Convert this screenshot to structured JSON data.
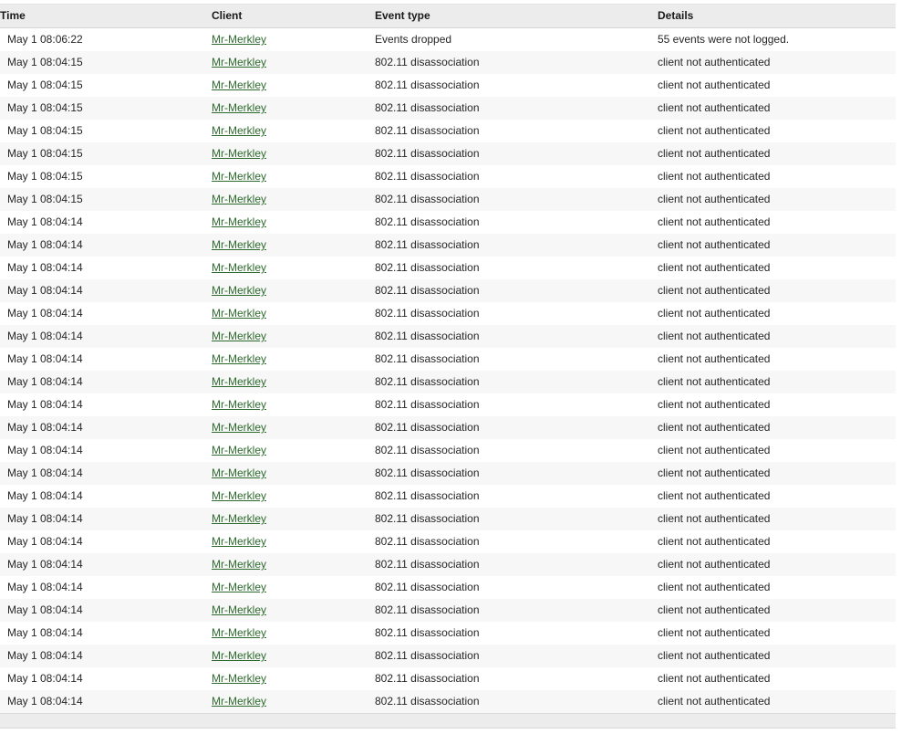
{
  "table": {
    "columns": [
      {
        "key": "time",
        "label": "Time"
      },
      {
        "key": "client",
        "label": "Client"
      },
      {
        "key": "event",
        "label": "Event type"
      },
      {
        "key": "details",
        "label": "Details"
      }
    ],
    "link_color": "#2d6a2d",
    "header_background": "#ececec",
    "stripe_color": "#f7f7f7",
    "rows": [
      {
        "time": "May 1 08:06:22",
        "client": "Mr-Merkley",
        "event": "Events dropped",
        "details": "55 events were not logged."
      },
      {
        "time": "May 1 08:04:15",
        "client": "Mr-Merkley",
        "event": "802.11 disassociation",
        "details": "client not authenticated"
      },
      {
        "time": "May 1 08:04:15",
        "client": "Mr-Merkley",
        "event": "802.11 disassociation",
        "details": "client not authenticated"
      },
      {
        "time": "May 1 08:04:15",
        "client": "Mr-Merkley",
        "event": "802.11 disassociation",
        "details": "client not authenticated"
      },
      {
        "time": "May 1 08:04:15",
        "client": "Mr-Merkley",
        "event": "802.11 disassociation",
        "details": "client not authenticated"
      },
      {
        "time": "May 1 08:04:15",
        "client": "Mr-Merkley",
        "event": "802.11 disassociation",
        "details": "client not authenticated"
      },
      {
        "time": "May 1 08:04:15",
        "client": "Mr-Merkley",
        "event": "802.11 disassociation",
        "details": "client not authenticated"
      },
      {
        "time": "May 1 08:04:15",
        "client": "Mr-Merkley",
        "event": "802.11 disassociation",
        "details": "client not authenticated"
      },
      {
        "time": "May 1 08:04:14",
        "client": "Mr-Merkley",
        "event": "802.11 disassociation",
        "details": "client not authenticated"
      },
      {
        "time": "May 1 08:04:14",
        "client": "Mr-Merkley",
        "event": "802.11 disassociation",
        "details": "client not authenticated"
      },
      {
        "time": "May 1 08:04:14",
        "client": "Mr-Merkley",
        "event": "802.11 disassociation",
        "details": "client not authenticated"
      },
      {
        "time": "May 1 08:04:14",
        "client": "Mr-Merkley",
        "event": "802.11 disassociation",
        "details": "client not authenticated"
      },
      {
        "time": "May 1 08:04:14",
        "client": "Mr-Merkley",
        "event": "802.11 disassociation",
        "details": "client not authenticated"
      },
      {
        "time": "May 1 08:04:14",
        "client": "Mr-Merkley",
        "event": "802.11 disassociation",
        "details": "client not authenticated"
      },
      {
        "time": "May 1 08:04:14",
        "client": "Mr-Merkley",
        "event": "802.11 disassociation",
        "details": "client not authenticated"
      },
      {
        "time": "May 1 08:04:14",
        "client": "Mr-Merkley",
        "event": "802.11 disassociation",
        "details": "client not authenticated"
      },
      {
        "time": "May 1 08:04:14",
        "client": "Mr-Merkley",
        "event": "802.11 disassociation",
        "details": "client not authenticated"
      },
      {
        "time": "May 1 08:04:14",
        "client": "Mr-Merkley",
        "event": "802.11 disassociation",
        "details": "client not authenticated"
      },
      {
        "time": "May 1 08:04:14",
        "client": "Mr-Merkley",
        "event": "802.11 disassociation",
        "details": "client not authenticated"
      },
      {
        "time": "May 1 08:04:14",
        "client": "Mr-Merkley",
        "event": "802.11 disassociation",
        "details": "client not authenticated"
      },
      {
        "time": "May 1 08:04:14",
        "client": "Mr-Merkley",
        "event": "802.11 disassociation",
        "details": "client not authenticated"
      },
      {
        "time": "May 1 08:04:14",
        "client": "Mr-Merkley",
        "event": "802.11 disassociation",
        "details": "client not authenticated"
      },
      {
        "time": "May 1 08:04:14",
        "client": "Mr-Merkley",
        "event": "802.11 disassociation",
        "details": "client not authenticated"
      },
      {
        "time": "May 1 08:04:14",
        "client": "Mr-Merkley",
        "event": "802.11 disassociation",
        "details": "client not authenticated"
      },
      {
        "time": "May 1 08:04:14",
        "client": "Mr-Merkley",
        "event": "802.11 disassociation",
        "details": "client not authenticated"
      },
      {
        "time": "May 1 08:04:14",
        "client": "Mr-Merkley",
        "event": "802.11 disassociation",
        "details": "client not authenticated"
      },
      {
        "time": "May 1 08:04:14",
        "client": "Mr-Merkley",
        "event": "802.11 disassociation",
        "details": "client not authenticated"
      },
      {
        "time": "May 1 08:04:14",
        "client": "Mr-Merkley",
        "event": "802.11 disassociation",
        "details": "client not authenticated"
      },
      {
        "time": "May 1 08:04:14",
        "client": "Mr-Merkley",
        "event": "802.11 disassociation",
        "details": "client not authenticated"
      },
      {
        "time": "May 1 08:04:14",
        "client": "Mr-Merkley",
        "event": "802.11 disassociation",
        "details": "client not authenticated"
      }
    ]
  },
  "footer": {
    "label": ""
  }
}
